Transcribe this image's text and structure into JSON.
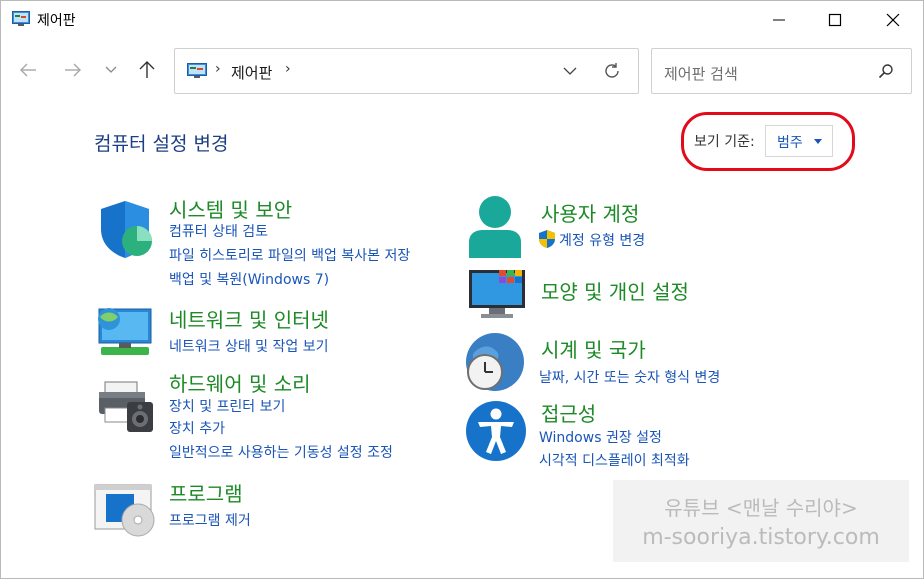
{
  "window": {
    "title": "제어판"
  },
  "address": {
    "path_label": "제어판",
    "separator": "›"
  },
  "search": {
    "placeholder": "제어판 검색"
  },
  "main": {
    "heading": "컴퓨터 설정 변경",
    "view_by_label": "보기 기준:",
    "view_by_value": "범주"
  },
  "categories_left": [
    {
      "title": "시스템 및 보안",
      "icon": "shield-icon",
      "links": [
        "컴퓨터 상태 검토",
        "파일 히스토리로 파일의 백업 복사본 저장",
        "백업 및 복원(Windows 7)"
      ]
    },
    {
      "title": "네트워크 및 인터넷",
      "icon": "network-icon",
      "links": [
        "네트워크 상태 및 작업 보기"
      ]
    },
    {
      "title": "하드웨어 및 소리",
      "icon": "printer-speaker-icon",
      "links": [
        "장치 및 프린터 보기",
        "장치 추가",
        "일반적으로 사용하는 기동성 설정 조정"
      ]
    },
    {
      "title": "프로그램",
      "icon": "programs-icon",
      "links": [
        "프로그램 제거"
      ]
    }
  ],
  "categories_right": [
    {
      "title": "사용자 계정",
      "icon": "user-icon",
      "links": [
        "계정 유형 변경"
      ]
    },
    {
      "title": "모양 및 개인 설정",
      "icon": "monitor-icon",
      "links": []
    },
    {
      "title": "시계 및 국가",
      "icon": "clock-globe-icon",
      "links": [
        "날짜, 시간 또는 숫자 형식 변경"
      ]
    },
    {
      "title": "접근성",
      "icon": "accessibility-icon",
      "links": [
        "Windows 권장 설정",
        "시각적 디스플레이 최적화"
      ]
    }
  ],
  "watermark": {
    "line1": "유튜브 <맨날 수리야>",
    "line2": "m-sooriya.tistory.com"
  },
  "colors": {
    "category_title": "#1d8a27",
    "link": "#1a55b8",
    "heading": "#1c3f83",
    "highlight": "#e30b1b"
  }
}
